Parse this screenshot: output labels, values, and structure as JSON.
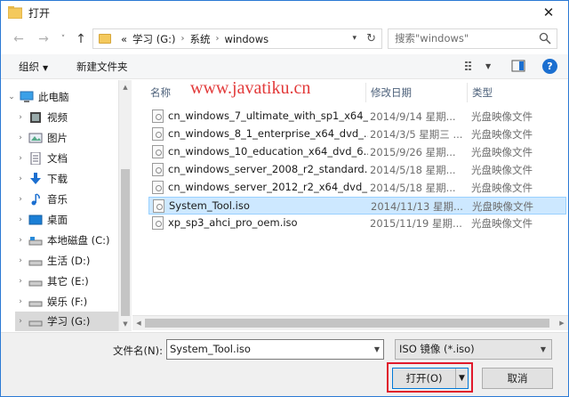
{
  "window": {
    "title": "打开",
    "close_glyph": "✕"
  },
  "nav": {
    "back": "←",
    "forward": "→",
    "history": "˅",
    "up": "↑",
    "address": {
      "overflow": "«",
      "crumbs": [
        "学习 (G:)",
        "系统",
        "windows"
      ],
      "separator": "›"
    },
    "search_placeholder": "搜索\"windows\""
  },
  "toolbar": {
    "organize": "组织",
    "new_folder": "新建文件夹"
  },
  "sidebar": {
    "items": [
      {
        "label": "此电脑",
        "icon": "computer-icon"
      },
      {
        "label": "视频",
        "icon": "video-icon"
      },
      {
        "label": "图片",
        "icon": "pictures-icon"
      },
      {
        "label": "文档",
        "icon": "documents-icon"
      },
      {
        "label": "下载",
        "icon": "download-icon"
      },
      {
        "label": "音乐",
        "icon": "music-icon"
      },
      {
        "label": "桌面",
        "icon": "desktop-icon"
      },
      {
        "label": "本地磁盘 (C:)",
        "icon": "drive-icon"
      },
      {
        "label": "生活 (D:)",
        "icon": "drive-icon"
      },
      {
        "label": "其它 (E:)",
        "icon": "drive-icon"
      },
      {
        "label": "娱乐 (F:)",
        "icon": "drive-icon"
      },
      {
        "label": "学习 (G:)",
        "icon": "drive-icon",
        "selected": true
      }
    ]
  },
  "filelist": {
    "watermark": "www.javatiku.cn",
    "columns": {
      "name": "名称",
      "date": "修改日期",
      "type": "类型"
    },
    "rows": [
      {
        "name": "cn_windows_7_ultimate_with_sp1_x64_...",
        "date": "2014/9/14 星期...",
        "type": "光盘映像文件"
      },
      {
        "name": "cn_windows_8_1_enterprise_x64_dvd_...",
        "date": "2014/3/5 星期三 ...",
        "type": "光盘映像文件"
      },
      {
        "name": "cn_windows_10_education_x64_dvd_6...",
        "date": "2015/9/26 星期...",
        "type": "光盘映像文件"
      },
      {
        "name": "cn_windows_server_2008_r2_standard...",
        "date": "2014/5/18 星期...",
        "type": "光盘映像文件"
      },
      {
        "name": "cn_windows_server_2012_r2_x64_dvd_...",
        "date": "2014/5/18 星期...",
        "type": "光盘映像文件"
      },
      {
        "name": "System_Tool.iso",
        "date": "2014/11/13 星期...",
        "type": "光盘映像文件",
        "selected": true
      },
      {
        "name": "xp_sp3_ahci_pro_oem.iso",
        "date": "2015/11/19 星期...",
        "type": "光盘映像文件"
      }
    ]
  },
  "bottom": {
    "filename_label": "文件名(N):",
    "filename_value": "System_Tool.iso",
    "filter_value": "ISO 镜像 (*.iso)",
    "open_label": "打开(O)",
    "cancel_label": "取消"
  },
  "colors": {
    "accent": "#0078d7",
    "selection": "#cde8ff",
    "highlight": "#e0192b",
    "watermark": "#e23a3a"
  }
}
